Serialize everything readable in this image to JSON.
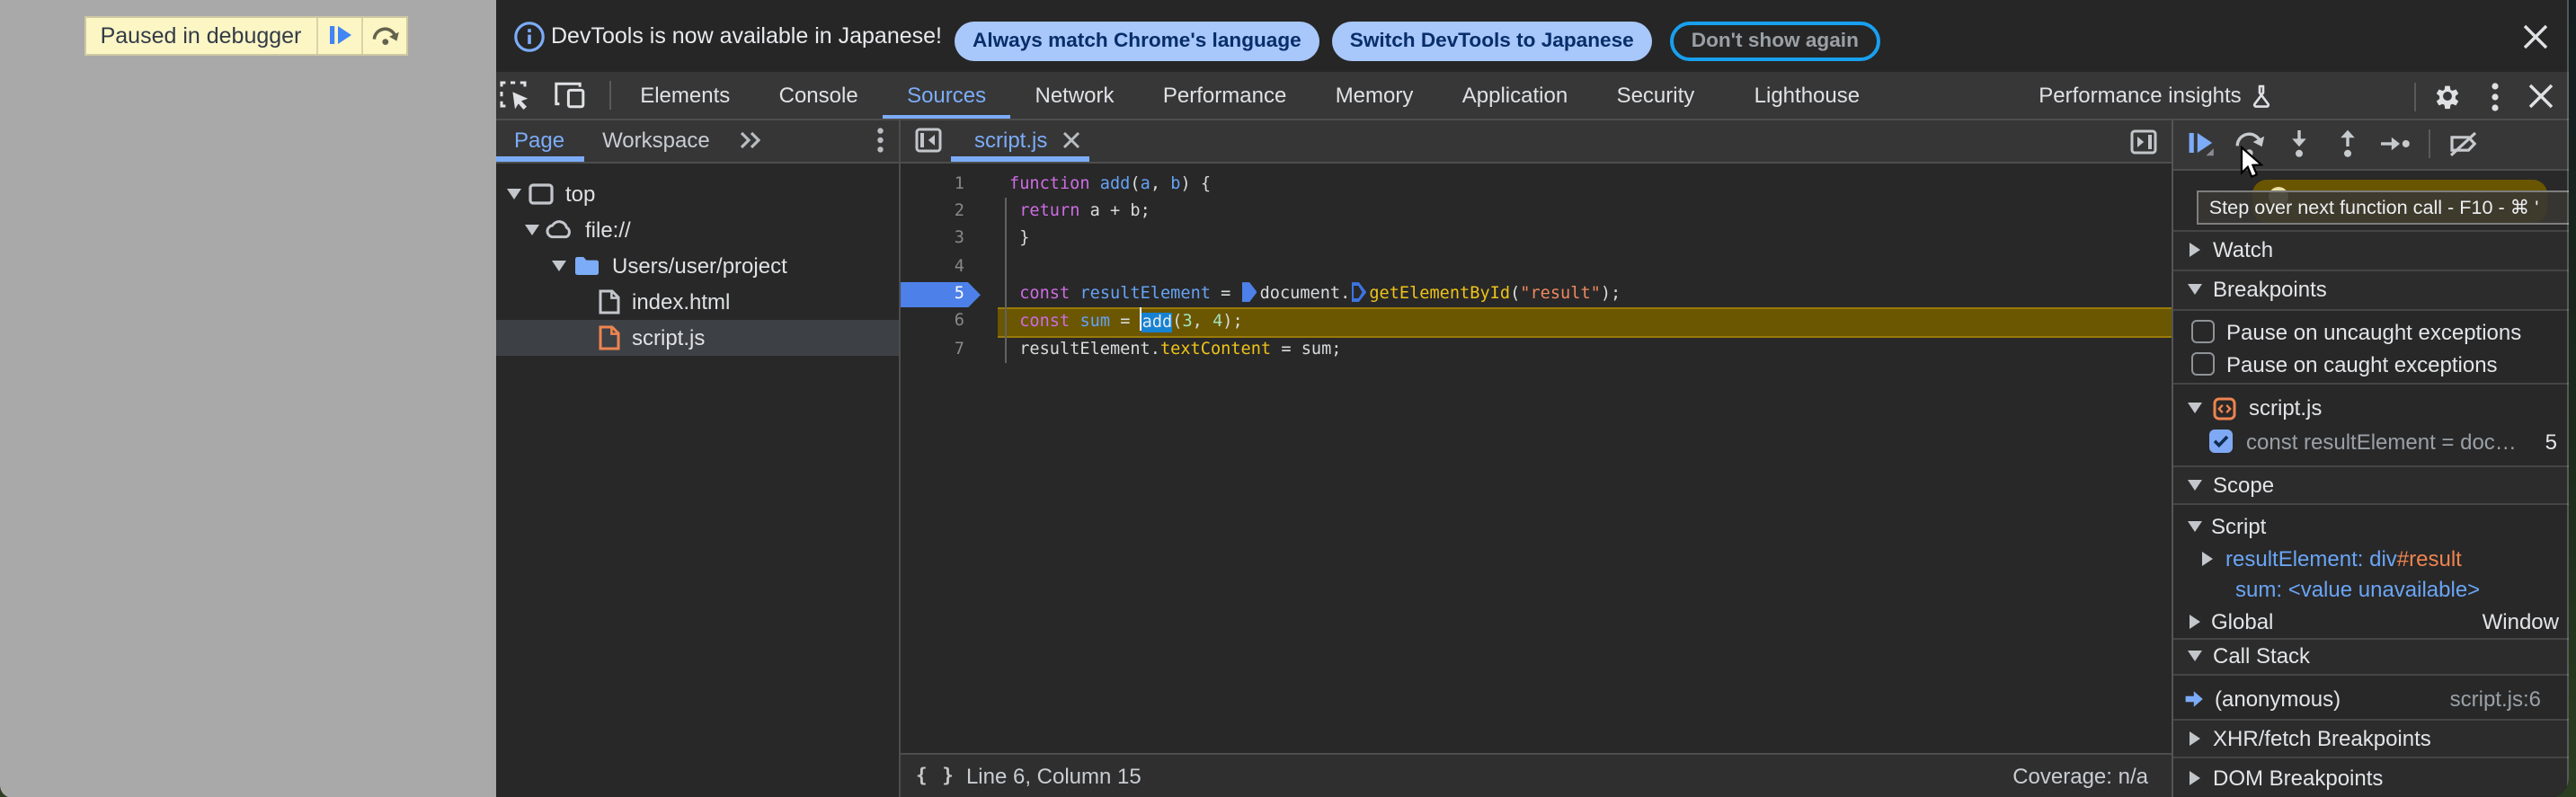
{
  "page_overlay": {
    "paused_label": "Paused in debugger",
    "resume_icon": "resume-script-icon",
    "step_over_icon": "step-over-icon"
  },
  "infobar": {
    "info_icon": "info-icon",
    "message": "DevTools is now available in Japanese!",
    "buttons": [
      {
        "label": "Always match Chrome's language",
        "style": "filled"
      },
      {
        "label": "Switch DevTools to Japanese",
        "style": "filled"
      },
      {
        "label": "Don't show again",
        "style": "outline"
      }
    ],
    "close_icon": "close-icon"
  },
  "main_toolbar": {
    "left_icons": [
      "inspect-element-icon",
      "device-toolbar-icon"
    ],
    "tabs": [
      {
        "label": "Elements",
        "active": false
      },
      {
        "label": "Console",
        "active": false
      },
      {
        "label": "Sources",
        "active": true
      },
      {
        "label": "Network",
        "active": false
      },
      {
        "label": "Performance",
        "active": false
      },
      {
        "label": "Memory",
        "active": false
      },
      {
        "label": "Application",
        "active": false
      },
      {
        "label": "Security",
        "active": false
      },
      {
        "label": "Lighthouse",
        "active": false
      },
      {
        "label": "Performance insights",
        "active": false,
        "icon": "flask-icon"
      }
    ],
    "right_icons": [
      "settings-gear-icon",
      "more-kebab-icon",
      "close-icon"
    ]
  },
  "navigator": {
    "tabs": [
      {
        "label": "Page",
        "active": true
      },
      {
        "label": "Workspace",
        "active": false
      }
    ],
    "more_tabs_icon": "chevron-double-right-icon",
    "menu_icon": "kebab-icon",
    "tree": [
      {
        "label": "top",
        "icon": "frame-icon",
        "expanded": true,
        "depth": 0
      },
      {
        "label": "file://",
        "icon": "cloud-icon",
        "expanded": true,
        "depth": 1
      },
      {
        "label": "Users/user/project",
        "icon": "folder-icon",
        "expanded": true,
        "depth": 2
      },
      {
        "label": "index.html",
        "icon": "file-icon-gray",
        "depth": 3,
        "selected": false
      },
      {
        "label": "script.js",
        "icon": "file-icon-orange",
        "depth": 3,
        "selected": true
      }
    ]
  },
  "editor": {
    "collapse_icon": "collapse-navigator-icon",
    "tab": {
      "label": "script.js",
      "close_icon": "close-icon",
      "active": true
    },
    "panel_icon": "open-debugger-panel-icon",
    "breakpoint_line": 5,
    "paused_line": 6,
    "code_lines": [
      {
        "n": 1,
        "tokens": [
          {
            "c": "kw",
            "t": "function"
          },
          {
            "c": "pln",
            "t": " "
          },
          {
            "c": "def",
            "t": "add"
          },
          {
            "c": "pln",
            "t": "("
          },
          {
            "c": "def",
            "t": "a"
          },
          {
            "c": "pln",
            "t": ", "
          },
          {
            "c": "def",
            "t": "b"
          },
          {
            "c": "pln",
            "t": ") {"
          }
        ]
      },
      {
        "n": 2,
        "tokens": [
          {
            "c": "pln",
            "t": " "
          },
          {
            "c": "kw",
            "t": "return"
          },
          {
            "c": "pln",
            "t": " a + b;"
          }
        ]
      },
      {
        "n": 3,
        "tokens": [
          {
            "c": "pln",
            "t": " }"
          }
        ]
      },
      {
        "n": 4,
        "tokens": []
      },
      {
        "n": 5,
        "tokens": [
          {
            "c": "pln",
            "t": " "
          },
          {
            "c": "kw",
            "t": "const"
          },
          {
            "c": "pln",
            "t": " "
          },
          {
            "c": "def",
            "t": "resultElement"
          },
          {
            "c": "pln",
            "t": " = "
          },
          {
            "c": "mk1",
            "t": ""
          },
          {
            "c": "pln",
            "t": "document."
          },
          {
            "c": "mk0",
            "t": ""
          },
          {
            "c": "prop",
            "t": "getElementById"
          },
          {
            "c": "pln",
            "t": "("
          },
          {
            "c": "str",
            "t": "\"result\""
          },
          {
            "c": "pln",
            "t": ");"
          }
        ]
      },
      {
        "n": 6,
        "tokens": [
          {
            "c": "pln",
            "t": " "
          },
          {
            "c": "kw",
            "t": "const"
          },
          {
            "c": "pln",
            "t": " "
          },
          {
            "c": "def",
            "t": "sum"
          },
          {
            "c": "pln",
            "t": " = "
          },
          {
            "c": "caret",
            "t": ""
          },
          {
            "c": "sel",
            "t": "add"
          },
          {
            "c": "pln",
            "t": "("
          },
          {
            "c": "num",
            "t": "3"
          },
          {
            "c": "pln",
            "t": ", "
          },
          {
            "c": "num",
            "t": "4"
          },
          {
            "c": "pln",
            "t": ");"
          }
        ]
      },
      {
        "n": 7,
        "tokens": [
          {
            "c": "pln",
            "t": " "
          },
          {
            "c": "pln",
            "t": "resultElement."
          },
          {
            "c": "prop",
            "t": "textContent"
          },
          {
            "c": "pln",
            "t": " = sum;"
          }
        ]
      }
    ],
    "status": {
      "braces_icon": "curly-braces-icon",
      "position": "Line 6, Column 15",
      "coverage": "Coverage: n/a"
    }
  },
  "debugger": {
    "toolbar_icons": [
      "resume-script-icon",
      "step-over-icon",
      "step-into-icon",
      "step-out-icon",
      "step-icon",
      "deactivate-breakpoints-icon"
    ],
    "tooltip": "Step over next function call - F10 - ⌘ '",
    "sections": {
      "watch": {
        "label": "Watch",
        "expanded": false
      },
      "breakpoints": {
        "label": "Breakpoints",
        "expanded": true,
        "pause_uncaught": {
          "label": "Pause on uncaught exceptions",
          "checked": false
        },
        "pause_caught": {
          "label": "Pause on caught exceptions",
          "checked": false
        },
        "file_group": {
          "label": "script.js",
          "icon": "script-file-icon",
          "expanded": true
        },
        "entry": {
          "label": "const resultElement = doc…",
          "line": "5",
          "checked": true
        }
      },
      "scope": {
        "label": "Scope",
        "expanded": true,
        "script_scope": {
          "label": "Script",
          "expanded": true
        },
        "vars": [
          {
            "name": "resultElement",
            "value_tag": "div",
            "value_id": "#result",
            "expandable": true
          },
          {
            "name": "sum",
            "value": "<value unavailable>",
            "expandable": false
          }
        ],
        "global_scope": {
          "label": "Global",
          "value": "Window",
          "expanded": false
        }
      },
      "call_stack": {
        "label": "Call Stack",
        "expanded": true,
        "frames": [
          {
            "name": "(anonymous)",
            "location": "script.js:6",
            "active": true
          }
        ]
      },
      "xhr_breakpoints": {
        "label": "XHR/fetch Breakpoints",
        "expanded": false
      },
      "dom_breakpoints": {
        "label": "DOM Breakpoints",
        "expanded": false
      }
    }
  }
}
